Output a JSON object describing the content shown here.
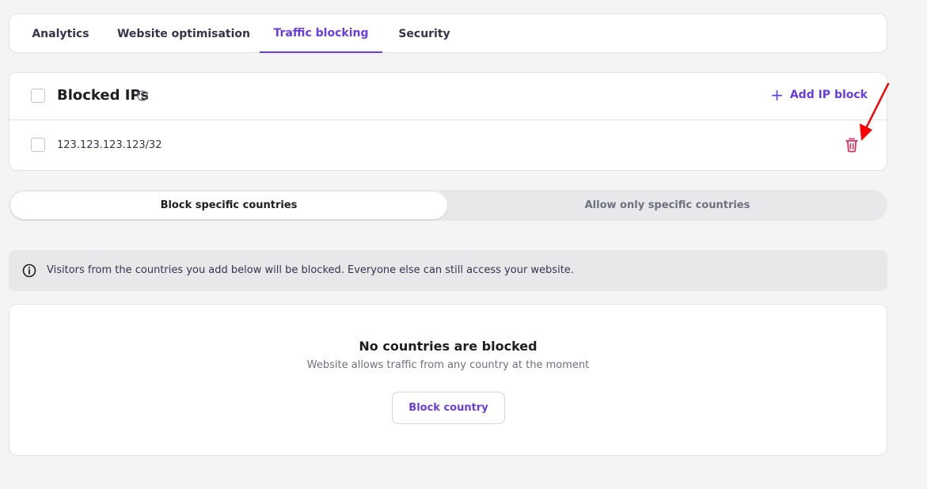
{
  "tabs": [
    {
      "label": "Analytics",
      "active": false
    },
    {
      "label": "Website optimisation",
      "active": false
    },
    {
      "label": "Traffic blocking",
      "active": true
    },
    {
      "label": "Security",
      "active": false
    }
  ],
  "blocked_ips": {
    "title": "Blocked IPs",
    "add_label": "Add IP block",
    "rows": [
      {
        "ip": "123.123.123.123/32"
      }
    ]
  },
  "mode_toggle": {
    "options": [
      "Block specific countries",
      "Allow only specific countries"
    ],
    "selected": "Block specific countries"
  },
  "info_banner": {
    "text": "Visitors from the countries you add below will be blocked. Everyone else can still access your website."
  },
  "empty_state": {
    "title": "No countries are blocked",
    "subtitle": "Website allows traffic from any country at the moment",
    "button_label": "Block country"
  },
  "colors": {
    "accent": "#673de6",
    "danger": "#d63163",
    "annotation_arrow": "#ff0000"
  },
  "icons": {
    "info": "info-circle-icon",
    "add": "plus-icon",
    "delete": "trash-icon",
    "annotation": "red-arrow-icon"
  }
}
